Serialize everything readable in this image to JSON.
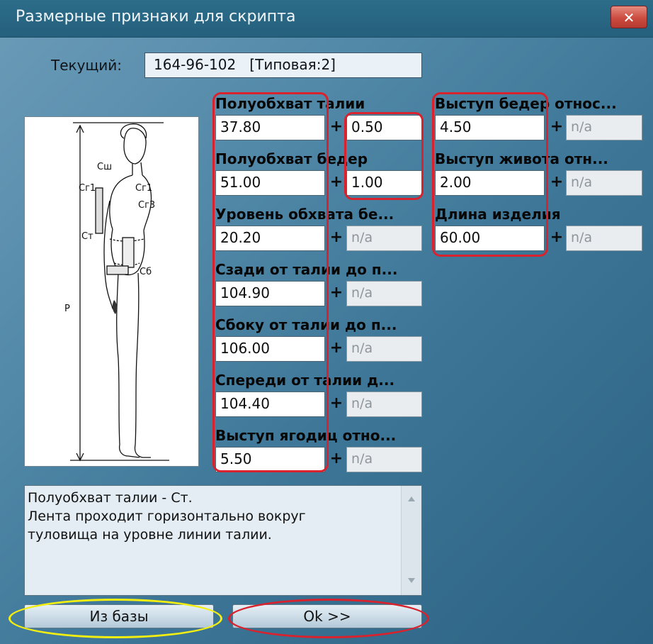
{
  "window": {
    "title": "Размерные признаки для скрипта",
    "close_label": "✕"
  },
  "current": {
    "label": "Текущий:",
    "value": "164-96-102   [Типовая:2]"
  },
  "figure": {
    "labels": {
      "csh": "Сш",
      "cg1_left": "Сг1",
      "cg1_right": "Сг1",
      "cg3": "Сг3",
      "ct": "Ст",
      "cb": "Сб",
      "p": "Р"
    }
  },
  "plus": "+",
  "left_fields": [
    {
      "label": "Полуобхват талии",
      "value": "37.80",
      "allowance": "0.50"
    },
    {
      "label": "Полуобхват бедер",
      "value": "51.00",
      "allowance": "1.00"
    },
    {
      "label": "Уровень обхвата бе...",
      "value": "20.20",
      "allowance": "n/a"
    },
    {
      "label": "Сзади от талии до п...",
      "value": "104.90",
      "allowance": "n/a"
    },
    {
      "label": "Сбоку от талии до п...",
      "value": "106.00",
      "allowance": "n/a"
    },
    {
      "label": "Спереди от талии д...",
      "value": "104.40",
      "allowance": "n/a"
    },
    {
      "label": "Выступ ягодиц отно...",
      "value": "5.50",
      "allowance": "n/a"
    }
  ],
  "right_fields": [
    {
      "label": "Выступ бедер относ...",
      "value": "4.50",
      "allowance": "n/a"
    },
    {
      "label": "Выступ живота отн...",
      "value": "2.00",
      "allowance": "n/a"
    },
    {
      "label": "Длина изделия",
      "value": "60.00",
      "allowance": "n/a"
    }
  ],
  "description": "Полуобхват талии - Ст.\nЛента проходит горизонтально вокруг\nтуловища на уровне линии талии.",
  "buttons": {
    "from_db": "Из базы",
    "ok": "Ok >>"
  },
  "colors": {
    "annotation_red": "#d8222d",
    "annotation_yellow": "#f2ee12"
  }
}
